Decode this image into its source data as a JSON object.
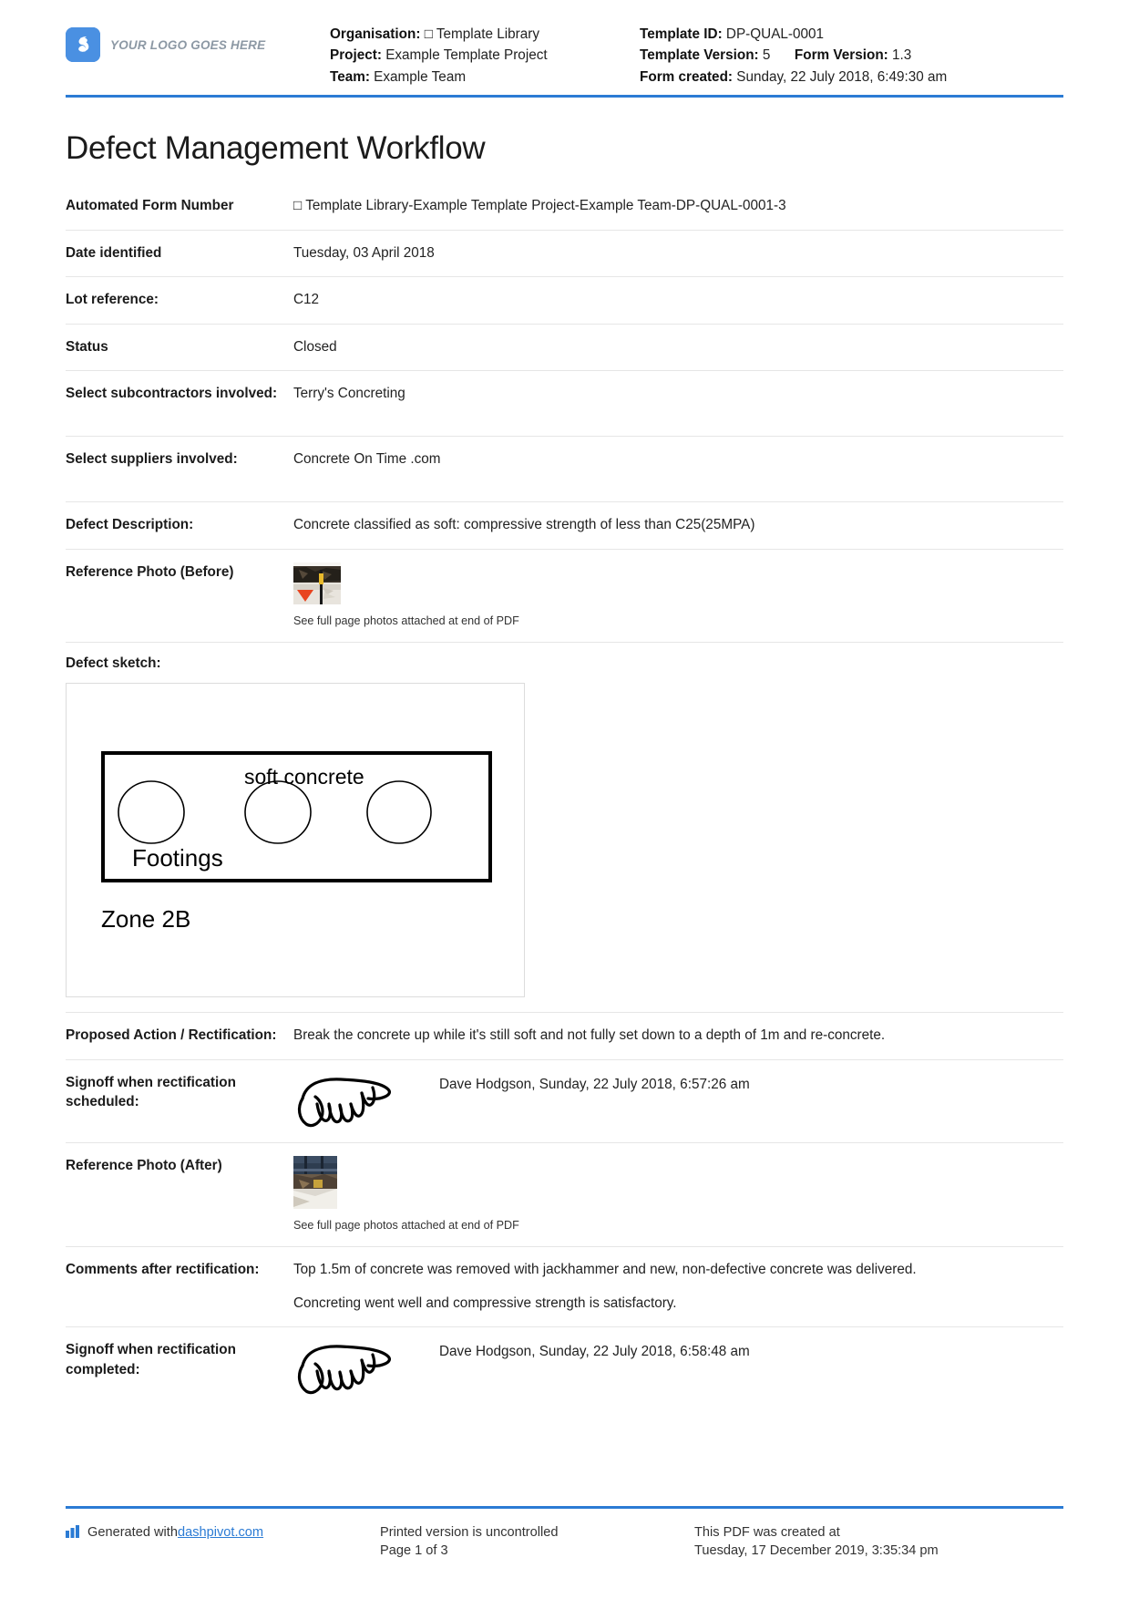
{
  "header": {
    "logo_text": "YOUR LOGO GOES HERE",
    "logo_color": "#4a90e2",
    "accent_color": "#2b7bd4",
    "organisation_label": "Organisation:",
    "organisation_value": "□ Template Library",
    "project_label": "Project:",
    "project_value": "Example Template Project",
    "team_label": "Team:",
    "team_value": "Example Team",
    "template_id_label": "Template ID:",
    "template_id_value": "DP-QUAL-0001",
    "template_version_label": "Template Version:",
    "template_version_value": "5",
    "form_version_label": "Form Version:",
    "form_version_value": "1.3",
    "form_created_label": "Form created:",
    "form_created_value": "Sunday, 22 July 2018, 6:49:30 am"
  },
  "title": "Defect Management Workflow",
  "fields": {
    "automated_form_number_label": "Automated Form Number",
    "automated_form_number_value": "□ Template Library-Example Template Project-Example Team-DP-QUAL-0001-3",
    "date_identified_label": "Date identified",
    "date_identified_value": "Tuesday, 03 April 2018",
    "lot_reference_label": "Lot reference:",
    "lot_reference_value": "C12",
    "status_label": "Status",
    "status_value": "Closed",
    "subcontractors_label": "Select subcontractors involved:",
    "subcontractors_value": "Terry's Concreting",
    "suppliers_label": "Select suppliers involved:",
    "suppliers_value": "Concrete On Time .com",
    "defect_description_label": "Defect Description:",
    "defect_description_value": "Concrete classified as soft: compressive strength of less than C25(25MPA)",
    "reference_photo_before_label": "Reference Photo (Before)",
    "reference_photo_before_caption": "See full page photos attached at end of PDF",
    "defect_sketch_label": "Defect sketch:",
    "proposed_action_label": "Proposed Action / Rectification:",
    "proposed_action_value": "Break the concrete up while it's still soft and not fully set down to a depth of 1m and re-concrete.",
    "signoff_scheduled_label": "Signoff when rectification scheduled:",
    "signoff_scheduled_value": "Dave Hodgson, Sunday, 22 July 2018, 6:57:26 am",
    "reference_photo_after_label": "Reference Photo (After)",
    "reference_photo_after_caption": "See full page photos attached at end of PDF",
    "comments_after_label": "Comments after rectification:",
    "comments_after_value_1": "Top 1.5m of concrete was removed with jackhammer and new, non-defective concrete was delivered.",
    "comments_after_value_2": "Concreting went well and compressive strength is satisfactory.",
    "signoff_completed_label": "Signoff when rectification completed:",
    "signoff_completed_value": "Dave Hodgson, Sunday, 22 July 2018, 6:58:48 am"
  },
  "sketch": {
    "soft_concrete_label": "soft concrete",
    "footings_label": "Footings",
    "zone_label": "Zone 2B"
  },
  "footer": {
    "generated_prefix": "Generated with ",
    "generated_link": "dashpivot.com",
    "uncontrolled": "Printed version is uncontrolled",
    "page": "Page 1 of 3",
    "created_at_label": "This PDF was created at",
    "created_at_value": "Tuesday, 17 December 2019, 3:35:34 pm"
  }
}
